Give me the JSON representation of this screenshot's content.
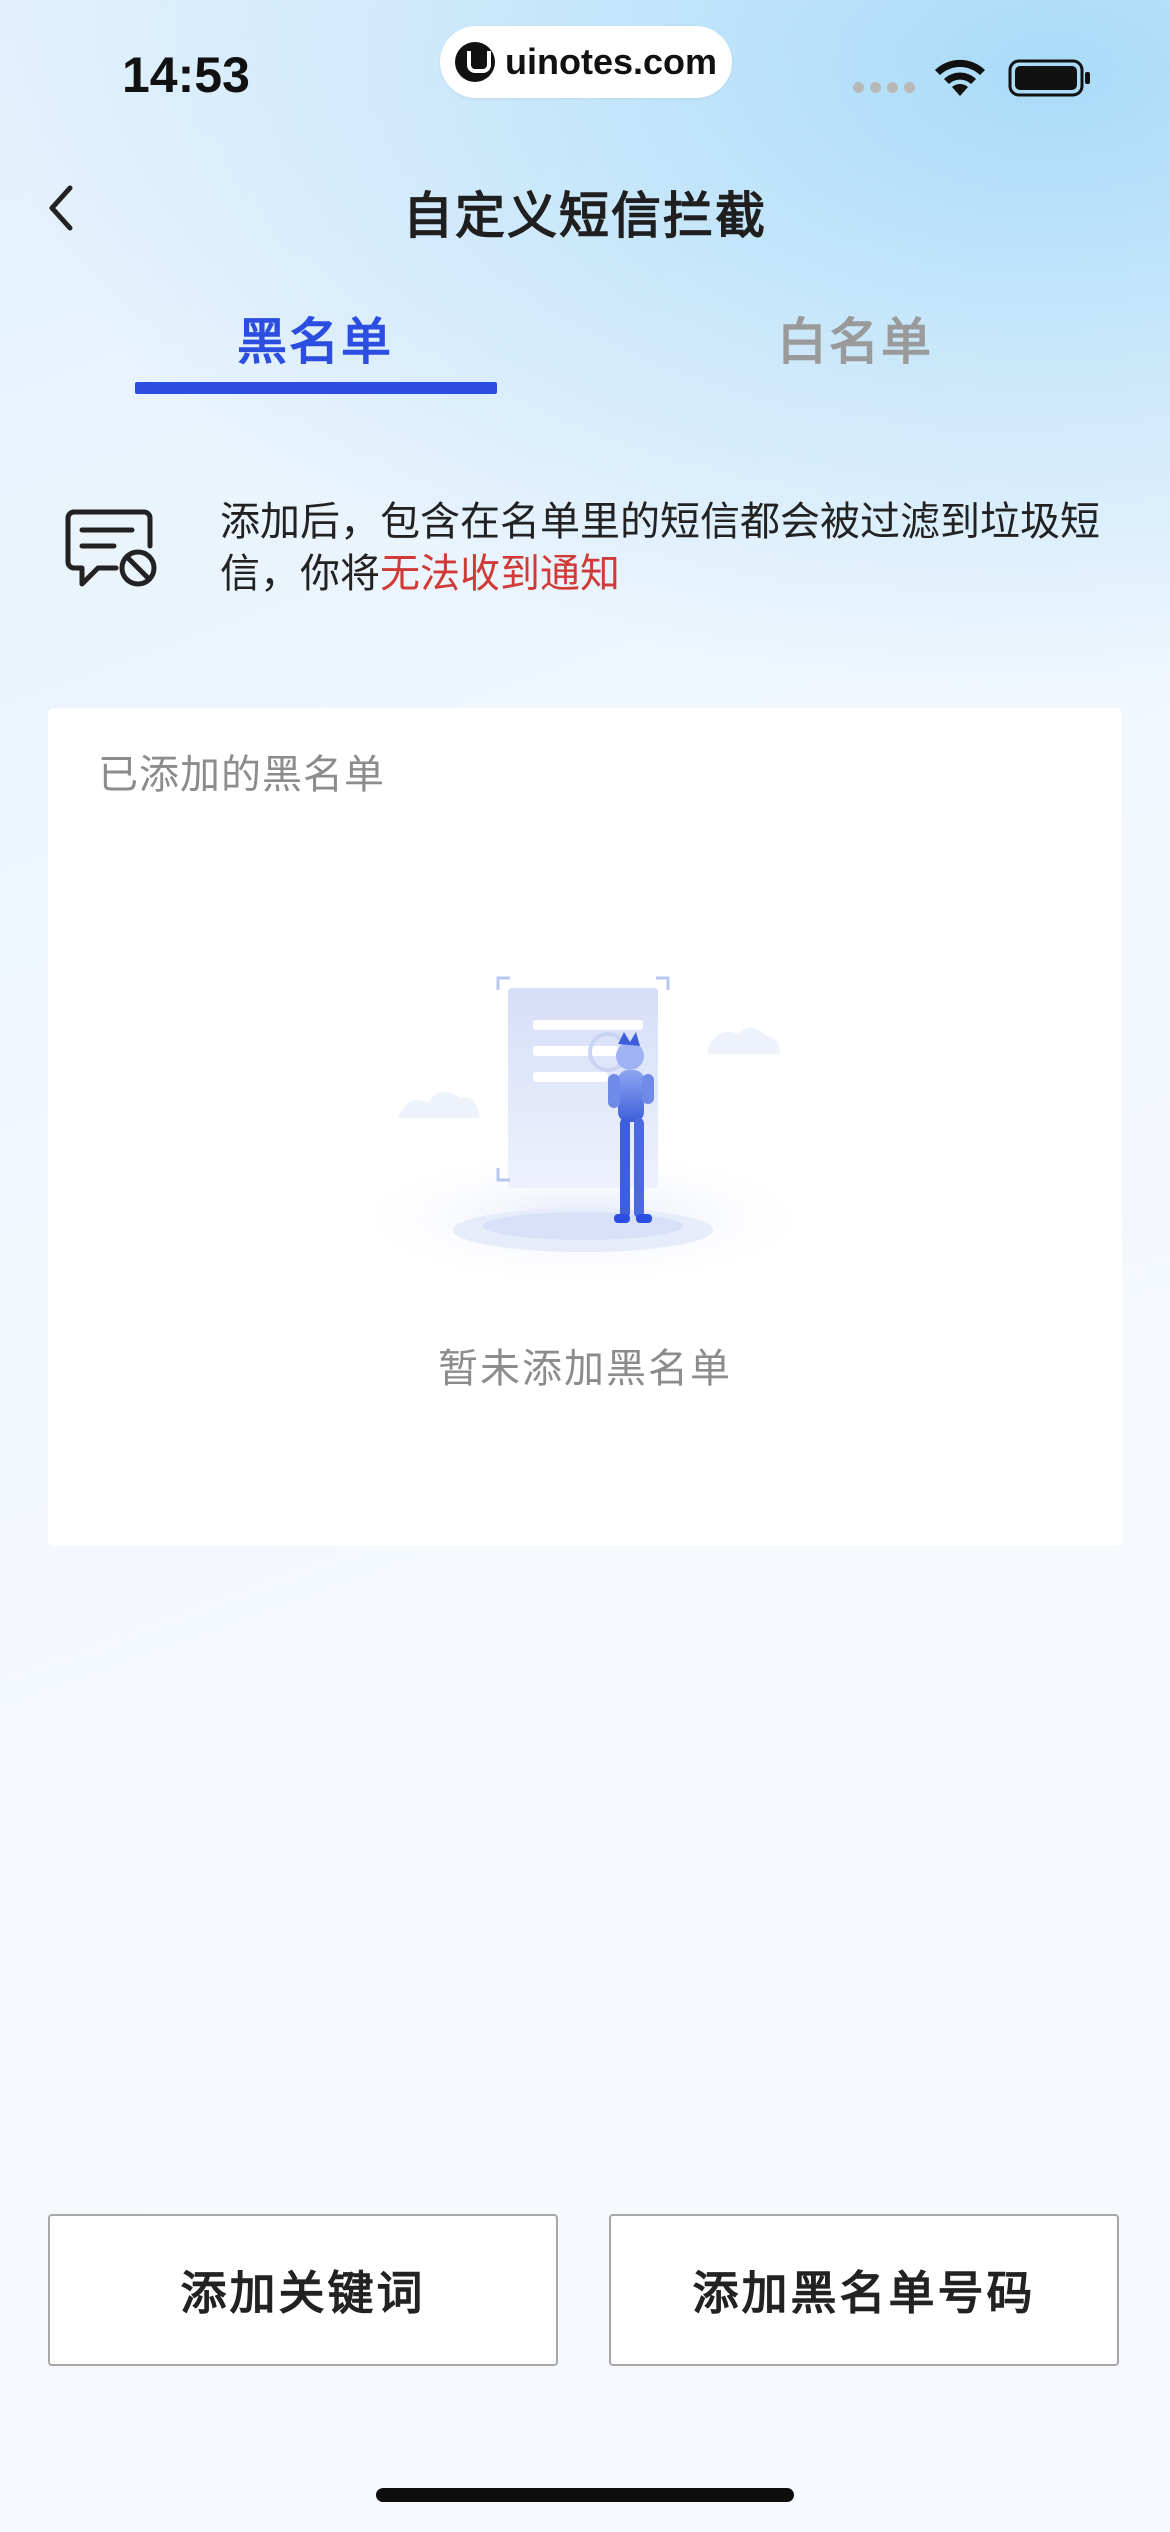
{
  "status_bar": {
    "time": "14:53",
    "url": "uinotes.com"
  },
  "header": {
    "title": "自定义短信拦截"
  },
  "tabs": [
    {
      "label": "黑名单",
      "active": true
    },
    {
      "label": "白名单",
      "active": false
    }
  ],
  "notice": {
    "text": "添加后，包含在名单里的短信都会被过滤到垃圾短信，你将",
    "warning": "无法收到通知"
  },
  "list_card": {
    "title": "已添加的黑名单",
    "empty_text": "暂未添加黑名单"
  },
  "actions": {
    "add_keyword": "添加关键词",
    "add_number": "添加黑名单号码"
  },
  "colors": {
    "accent": "#2c4ee0",
    "warning": "#d03a37"
  }
}
